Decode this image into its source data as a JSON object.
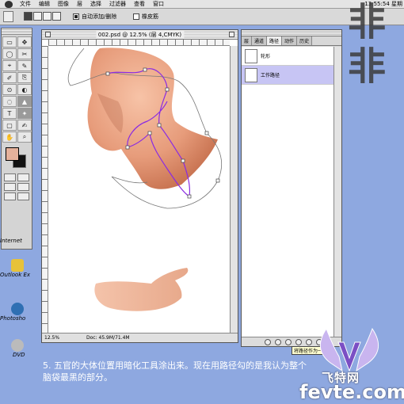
{
  "menubar": {
    "items": [
      "文件",
      "编辑",
      "图像",
      "层",
      "选择",
      "过滤器",
      "查看",
      "窗口"
    ],
    "clock": "13:55:54 星期"
  },
  "options_bar": {
    "auto_add_delete_label": "自动添加/删除",
    "rubber_band_label": "橡皮筋",
    "auto_add_delete_checked": true,
    "rubber_band_checked": false
  },
  "watermark_letters": [
    "非",
    "非"
  ],
  "toolbox": {
    "tools": [
      "▭",
      "✥",
      "◯",
      "✂",
      "⌖",
      "✎",
      "✐",
      "⎘",
      "⊙",
      "◐",
      "◌",
      "▲",
      "T",
      "✦",
      "▢",
      "✍",
      "✋",
      "⌕"
    ],
    "foreground_color": "#e5b19b",
    "background_color": "#111111"
  },
  "desktop_icons": [
    {
      "label": "Internet"
    },
    {
      "label": "Outlook Ex"
    },
    {
      "label": "Photosho"
    },
    {
      "label": "DVD"
    }
  ],
  "document": {
    "title": "002.psd @ 12.5% (层 4,CMYK)",
    "zoom": "12.5%",
    "doc_info": "Doc: 45.9M/71.4M"
  },
  "paths_panel": {
    "tabs": [
      "层",
      "通道",
      "路径",
      "动作",
      "历史"
    ],
    "active_tab": "路径",
    "paths": [
      {
        "name": "轮形",
        "selected": false
      },
      {
        "name": "工作路径",
        "selected": true
      }
    ],
    "tooltip": "将路径作为一..."
  },
  "caption": {
    "line1": "5. 五官的大体位置用暗化工具涂出来。现在用路径勾的是我认为整个",
    "line2": "脑袋最黑的部分。"
  },
  "logo": {
    "brand": "飞特网",
    "domain": "fevte.com"
  }
}
